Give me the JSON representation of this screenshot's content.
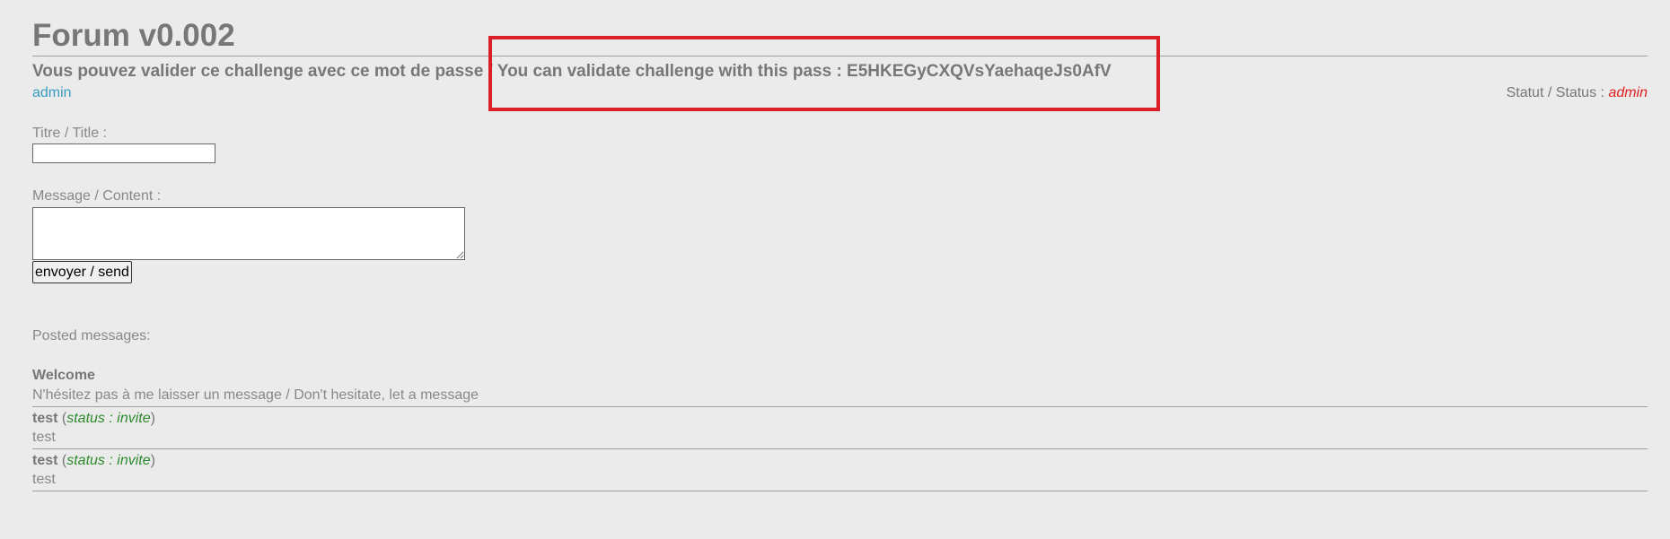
{
  "header": {
    "title": "Forum v0.002",
    "subtitle": "Vous pouvez valider ce challenge avec ce mot de passe / You can validate challenge with this pass : E5HKEGyCXQVsYaehaqeJs0AfV"
  },
  "user": {
    "name": "admin",
    "status_label": "Statut / Status : ",
    "status_value": "admin"
  },
  "form": {
    "title_label": "Titre / Title :",
    "title_value": "",
    "content_label": "Message / Content :",
    "content_value": "",
    "send_label": "envoyer / send"
  },
  "posted": {
    "label": "Posted messages:",
    "messages": [
      {
        "title": "Welcome",
        "body": "N'hésitez pas à me laisser un message / Don't hesitate, let a message"
      },
      {
        "author": "test",
        "status_prefix": "status : ",
        "status_value": "invite",
        "body": "test"
      },
      {
        "author": "test",
        "status_prefix": "status : ",
        "status_value": "invite",
        "body": "test"
      }
    ]
  },
  "colors": {
    "background": "#ebebeb",
    "text": "#777777",
    "link": "#3a9cc1",
    "status_admin": "#e02020",
    "status_invite": "#2c8a2c",
    "highlight_box": "#d9202a"
  }
}
